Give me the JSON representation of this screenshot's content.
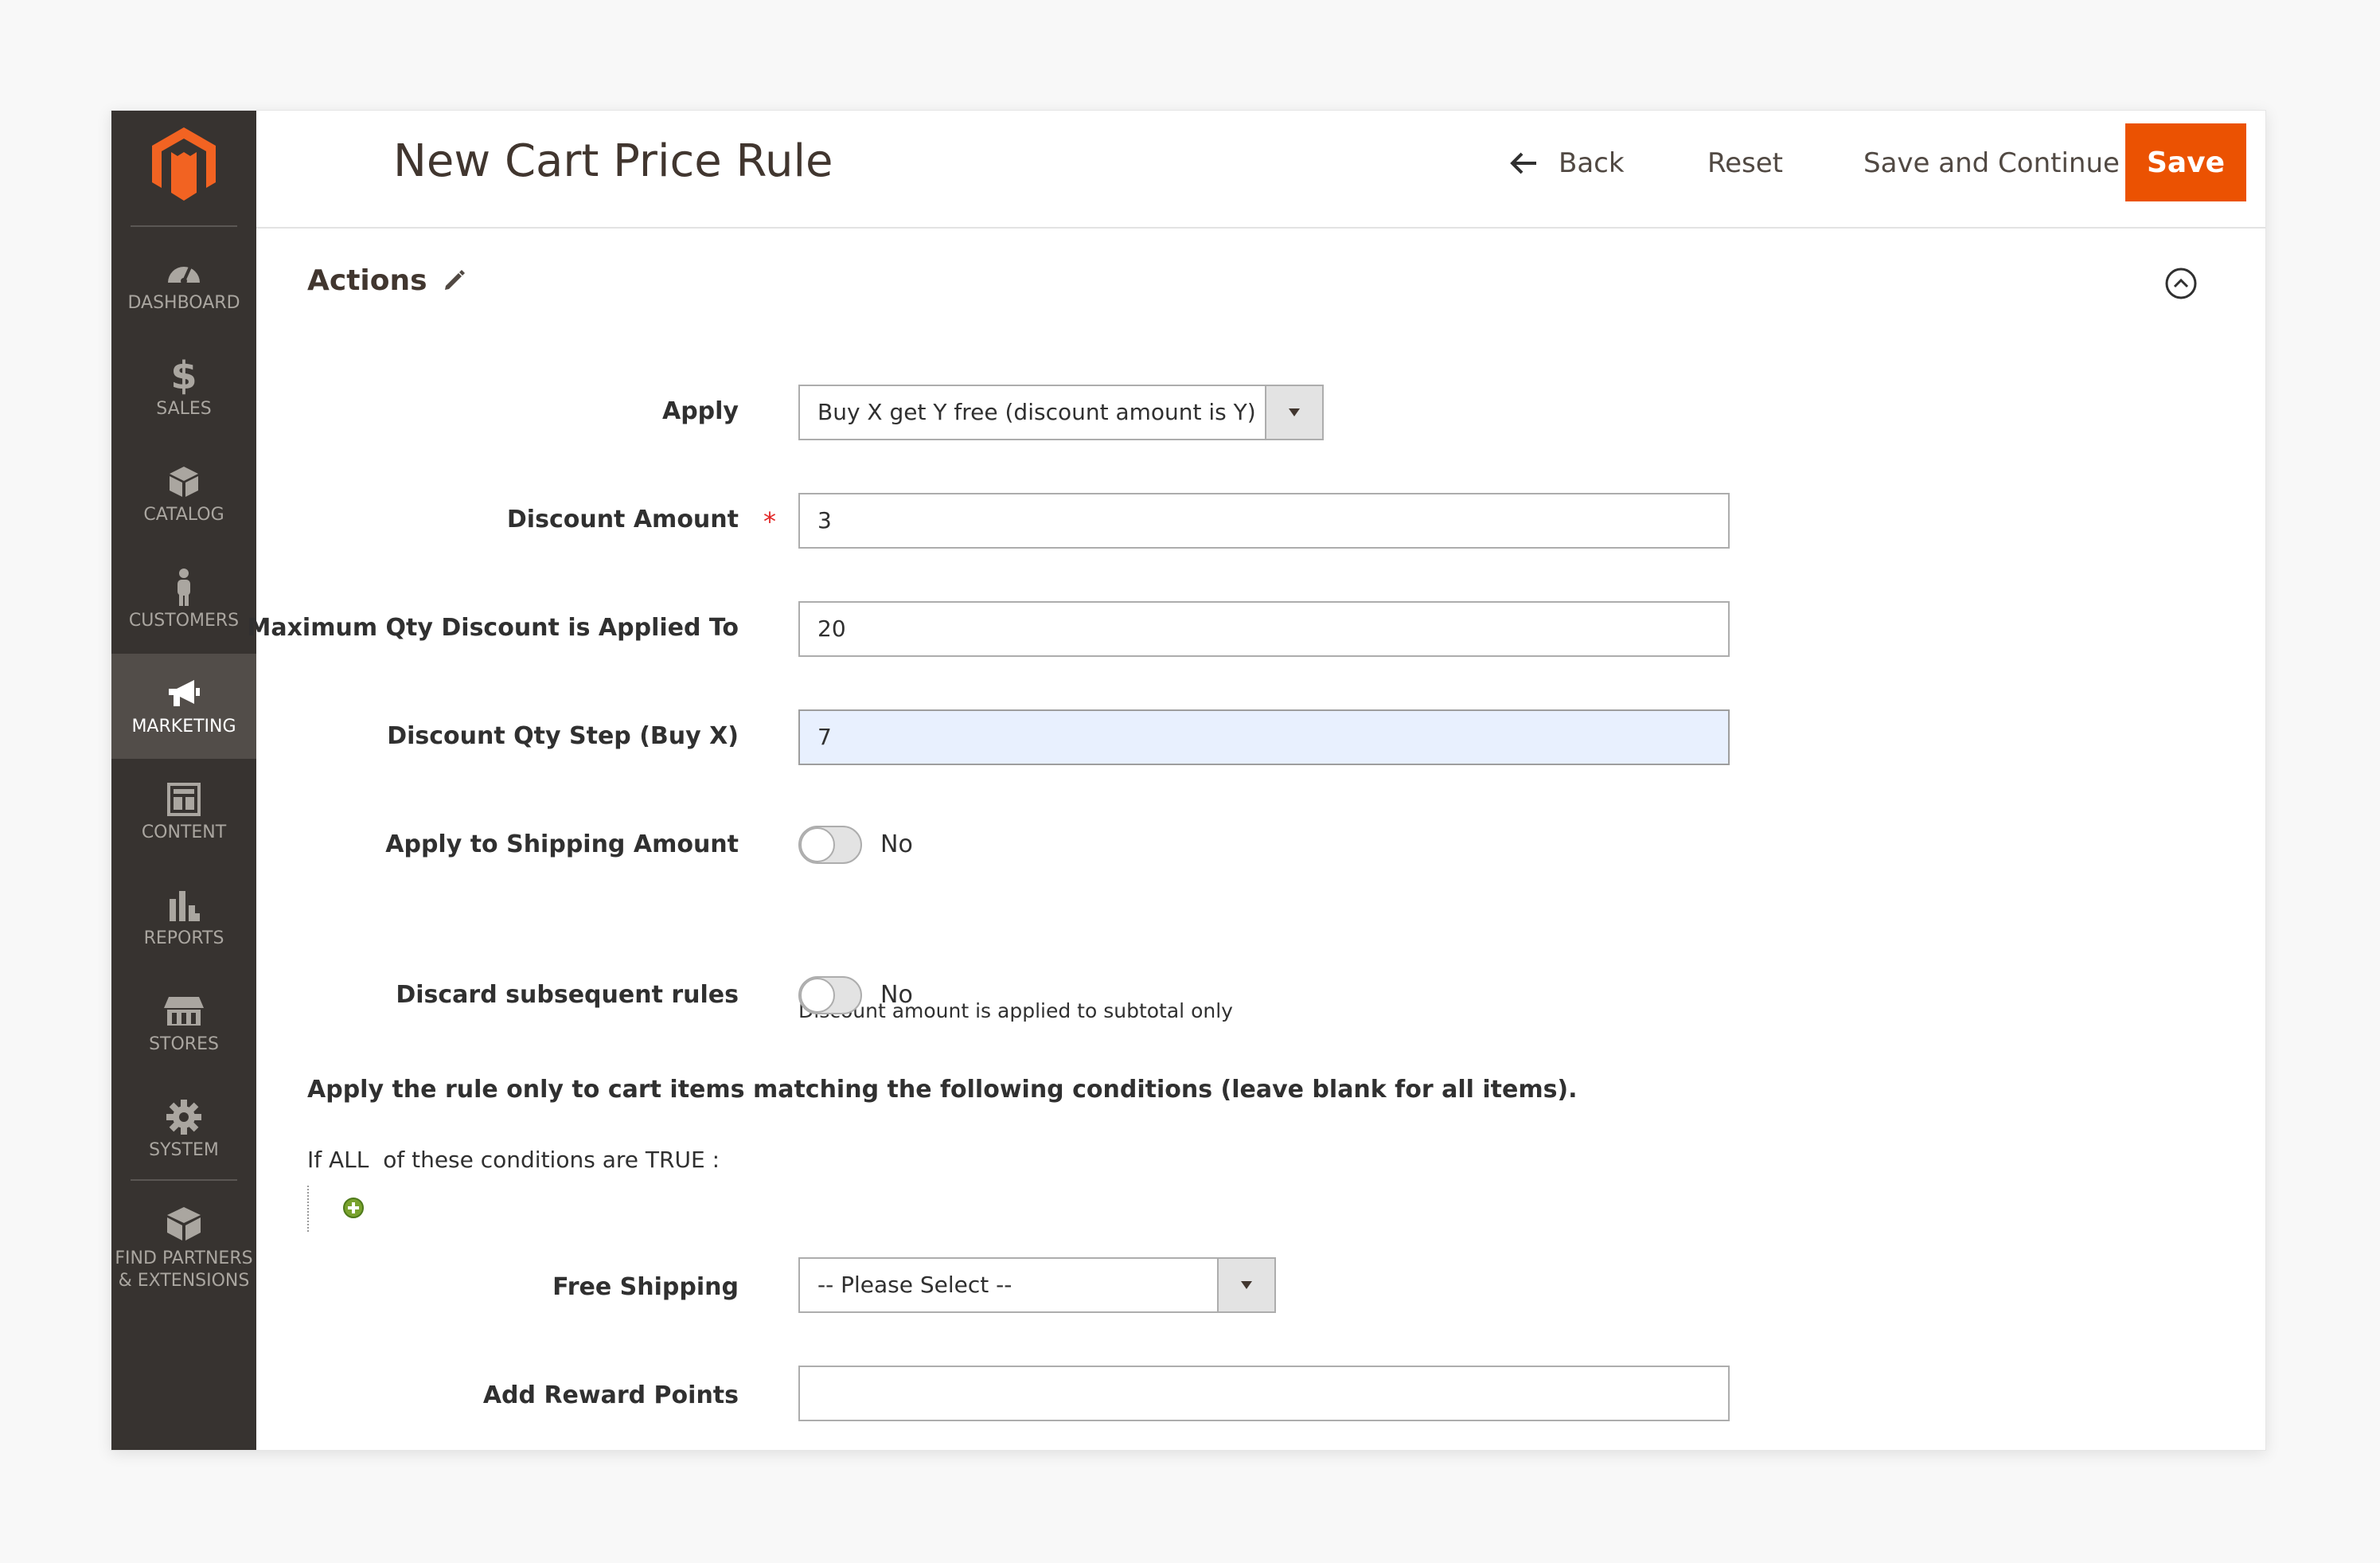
{
  "sidebar": {
    "items": [
      {
        "label": "DASHBOARD",
        "icon": "dashboard-icon",
        "active": false
      },
      {
        "label": "SALES",
        "icon": "dollar-icon",
        "active": false
      },
      {
        "label": "CATALOG",
        "icon": "box-icon",
        "active": false
      },
      {
        "label": "CUSTOMERS",
        "icon": "person-icon",
        "active": false
      },
      {
        "label": "MARKETING",
        "icon": "megaphone-icon",
        "active": true
      },
      {
        "label": "CONTENT",
        "icon": "layout-icon",
        "active": false
      },
      {
        "label": "REPORTS",
        "icon": "bar-chart-icon",
        "active": false
      },
      {
        "label": "STORES",
        "icon": "store-icon",
        "active": false
      },
      {
        "label": "SYSTEM",
        "icon": "gear-icon",
        "active": false
      }
    ],
    "extensions": {
      "line1": "FIND PARTNERS",
      "line2": "& EXTENSIONS",
      "icon": "cubes-icon"
    }
  },
  "header": {
    "title": "New Cart Price Rule",
    "back_label": "Back",
    "reset_label": "Reset",
    "save_continue_label": "Save and Continue Edit",
    "save_label": "Save"
  },
  "section": {
    "title": "Actions"
  },
  "form": {
    "apply": {
      "label": "Apply",
      "value": "Buy X get Y free (discount amount is Y)"
    },
    "discount_amount": {
      "label": "Discount Amount",
      "value": "3",
      "required_mark": "*"
    },
    "max_qty": {
      "label": "Maximum Qty Discount is Applied To",
      "value": "20"
    },
    "qty_step": {
      "label": "Discount Qty Step (Buy X)",
      "value": "7"
    },
    "apply_shipping": {
      "label": "Apply to Shipping Amount",
      "state": "No",
      "note": "Discount amount is applied to subtotal only"
    },
    "discard_rules": {
      "label": "Discard subsequent rules",
      "state": "No"
    },
    "free_shipping": {
      "label": "Free Shipping",
      "value": "-- Please Select --"
    },
    "reward_points": {
      "label": "Add Reward Points",
      "value": ""
    }
  },
  "conditions": {
    "heading": "Apply the rule only to cart items matching the following conditions (leave blank for all items).",
    "prefix": "If",
    "aggregator": "ALL",
    "middle": "of these conditions are",
    "value": "TRUE",
    "suffix": ":"
  },
  "colors": {
    "accent": "#eb5202",
    "sidebar_bg": "#373330",
    "sidebar_active": "#524d49",
    "focused_field": "#e8f0fe"
  }
}
